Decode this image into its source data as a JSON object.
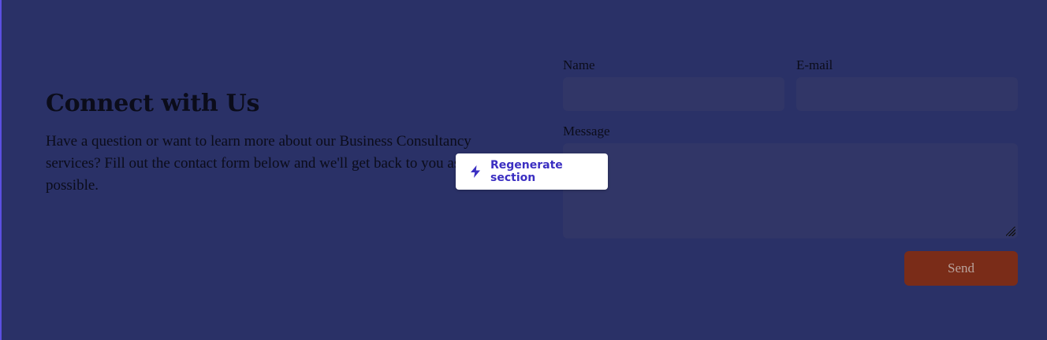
{
  "section": {
    "heading": "Connect with Us",
    "description": "Have a question or want to learn more about our Business Consultancy services? Fill out the contact form below and we'll get back to you as soon as possible."
  },
  "form": {
    "name_label": "Name",
    "name_value": "",
    "email_label": "E-mail",
    "email_value": "",
    "message_label": "Message",
    "message_value": "",
    "send_label": "Send"
  },
  "overlay": {
    "regenerate_label": "Regenerate section",
    "icon": "lightning-bolt-icon"
  },
  "colors": {
    "background": "#2a3167",
    "field_bg": "#313667",
    "send_button": "#7a2c18",
    "accent": "#3b2fc2",
    "edge_accent": "#5b4fe0"
  }
}
